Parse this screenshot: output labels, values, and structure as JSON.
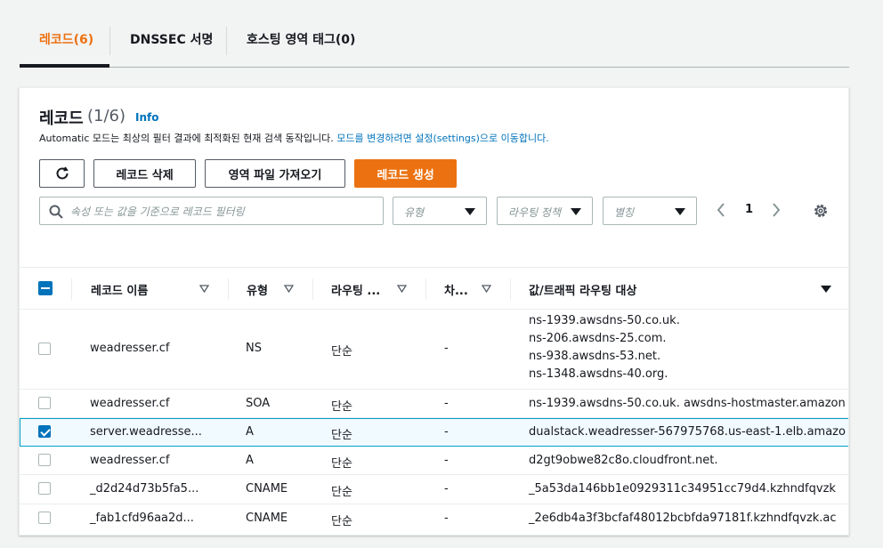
{
  "tabs": [
    {
      "label": "레코드(6)",
      "active": true
    },
    {
      "label": "DNSSEC 서명"
    },
    {
      "label": "호스팅 영역 태그(0)"
    }
  ],
  "panel": {
    "title": "레코드",
    "count": "(1/6)",
    "info": "Info",
    "desc_prefix": "Automatic 모드는 최상의 필터 결과에 최적화된 현재 검색 동작입니다.",
    "desc_link": "모드를 변경하려면 설정(settings)으로 이동합니다.",
    "buttons": {
      "delete": "레코드 삭제",
      "import": "영역 파일 가져오기",
      "create": "레코드 생성"
    },
    "search_placeholder": "속성 또는 값을 기준으로 레코드 필터링",
    "filters": {
      "type": "유형",
      "routing": "라우팅 정책",
      "alias": "별칭"
    },
    "page": "1"
  },
  "table": {
    "columns": {
      "name": "레코드 이름",
      "type": "유형",
      "routing": "라우팅 ...",
      "diff": "차...",
      "value": "값/트래픽 라우팅 대상"
    },
    "rows": [
      {
        "name": "weadresser.cf",
        "type": "NS",
        "routing": "단순",
        "diff": "-",
        "checked": false,
        "value": [
          "ns-1939.awsdns-50.co.uk.",
          "ns-206.awsdns-25.com.",
          "ns-938.awsdns-53.net.",
          "ns-1348.awsdns-40.org."
        ]
      },
      {
        "name": "weadresser.cf",
        "type": "SOA",
        "routing": "단순",
        "diff": "-",
        "checked": false,
        "value": [
          "ns-1939.awsdns-50.co.uk. awsdns-hostmaster.amazon"
        ]
      },
      {
        "name": "server.weadresse...",
        "type": "A",
        "routing": "단순",
        "diff": "-",
        "checked": true,
        "value": [
          "dualstack.weadresser-567975768.us-east-1.elb.amazo"
        ]
      },
      {
        "name": "weadresser.cf",
        "type": "A",
        "routing": "단순",
        "diff": "-",
        "checked": false,
        "value": [
          "d2gt9obwe82c8o.cloudfront.net."
        ]
      },
      {
        "name": "_d2d24d73b5fa5...",
        "type": "CNAME",
        "routing": "단순",
        "diff": "-",
        "checked": false,
        "value": [
          "_5a53da146bb1e0929311c34951cc79d4.kzhndfqvzk"
        ]
      },
      {
        "name": "_fab1cfd96aa2d...",
        "type": "CNAME",
        "routing": "단순",
        "diff": "-",
        "checked": false,
        "value": [
          "_2e6db4a3f3bcfaf48012bcbfda97181f.kzhndfqvzk.ac"
        ]
      }
    ]
  },
  "colors": {
    "accent": "#ec7211",
    "link": "#0073bb",
    "selected_bg": "#f1faff",
    "selected_border": "#00a1c9"
  }
}
